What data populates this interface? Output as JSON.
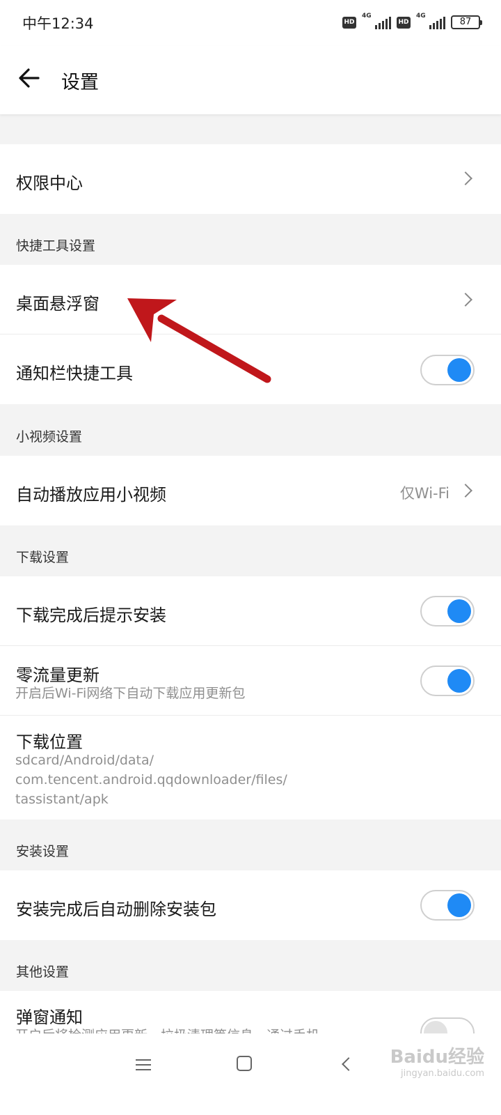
{
  "status_bar": {
    "time": "中午12:34",
    "hd_1": "HD",
    "net_1": "4G",
    "hd_2": "HD",
    "net_2": "4G",
    "battery": "87"
  },
  "header": {
    "title": "设置"
  },
  "permission_center": {
    "label": "权限中心"
  },
  "quick_tools": {
    "header": "快捷工具设置",
    "floating_window_label": "桌面悬浮窗",
    "notification_tools_label": "通知栏快捷工具",
    "notification_tools_on": true
  },
  "mini_video": {
    "header": "小视频设置",
    "autoplay_label": "自动播放应用小视频",
    "autoplay_value": "仅Wi-Fi"
  },
  "download": {
    "header": "下载设置",
    "prompt_install_label": "下载完成后提示安装",
    "prompt_install_on": true,
    "zero_traffic_label": "零流量更新",
    "zero_traffic_sub": "开启后Wi-Fi网络下自动下载应用更新包",
    "zero_traffic_on": true,
    "location_label": "下载位置",
    "location_path_1": "sdcard/Android/data/",
    "location_path_2": "com.tencent.android.qqdownloader/files/",
    "location_path_3": "tassistant/apk"
  },
  "install": {
    "header": "安装设置",
    "auto_delete_label": "安装完成后自动删除安装包",
    "auto_delete_on": true
  },
  "other": {
    "header": "其他设置",
    "popup_label": "弹窗通知",
    "popup_sub": "开启后将检测应用更新、垃圾清理等信息，通过手机",
    "popup_on": false
  },
  "watermark": {
    "main": "Baidu经验",
    "sub": "jingyan.baidu.com"
  },
  "colors": {
    "accent": "#1f8af5",
    "annotation_arrow": "#c0171b"
  }
}
